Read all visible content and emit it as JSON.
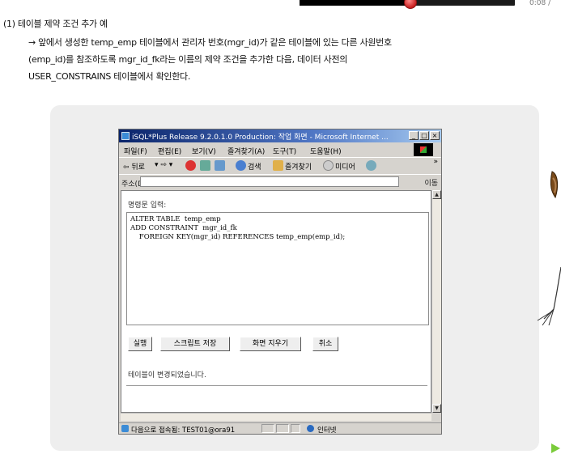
{
  "player": {
    "time": "0:08 /",
    "progress_fraction": 0.51
  },
  "heading": "(1) 테이블 제약 조건 추가 예",
  "paragraph": {
    "line1": "→ 앞에서 생성한 temp_emp 테이블에서 관리자 번호(mgr_id)가 같은 테이블에 있는 다른 사원번호",
    "line2": "(emp_id)를 참조하도록 mgr_id_fk라는 이름의 제약 조건을 추가한 다음, 데이터 사전의",
    "line3": "USER_CONSTRAINS 테이블에서 확인한다."
  },
  "window": {
    "title": "iSQL*Plus Release 9.2.0.1.0 Production: 작업 화면 - Microsoft Internet ...",
    "controls": [
      "_",
      "□",
      "×"
    ],
    "menu": [
      "파일(F)",
      "편집(E)",
      "보기(V)",
      "즐겨찾기(A)",
      "도구(T)",
      "도움말(H)"
    ],
    "toolbar": {
      "back": "⇦ 뒤로",
      "forward": "▾ ⇨ ▾",
      "search": "검색",
      "favorites": "즐겨찾기",
      "media": "미디어",
      "more": "»"
    },
    "address": {
      "label": "주소(D)",
      "go": "이동"
    },
    "content": {
      "command_label": "명령문 입력:",
      "sql": "ALTER TABLE  temp_emp\nADD CONSTRAINT  mgr_id_fk\n    FOREIGN KEY(mgr_id) REFERENCES temp_emp(emp_id);",
      "buttons": [
        "실행",
        "스크립트 저장",
        "화면 지우기",
        "취소"
      ],
      "result": "테이블이 변경되었습니다."
    },
    "status": {
      "text": "다음으로 접속됨: TEST01@ora91",
      "zone": "인터넷"
    }
  },
  "colors": {
    "titlebar": "#0a246a",
    "panel": "#eeeeee",
    "chrome": "#d6d3ce",
    "accent_green": "#7acb3a"
  }
}
